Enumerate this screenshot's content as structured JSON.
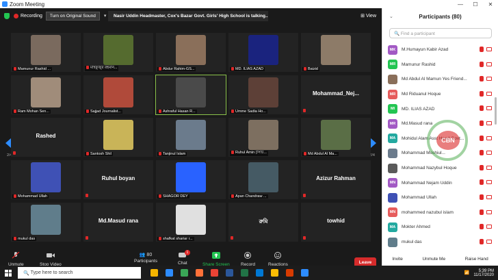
{
  "window": {
    "title": "Zoom Meeting",
    "controls": [
      "—",
      "☐",
      "✕"
    ]
  },
  "topbar": {
    "recording_label": "Recording",
    "sound_button": "Turn on Original Sound",
    "more": "▾",
    "speaker_banner": "Nasir   Uddin Headmaster, Cox's Bazar Govt. Girls' High School is talking...",
    "view_label": "View"
  },
  "pagination": {
    "left": "2/4",
    "right": "2/4"
  },
  "tiles": [
    {
      "name": "Mamunur Rashid ...",
      "photo": "#7a6a5e",
      "kind": "video"
    },
    {
      "name": "মাহফুজুর রহমান...",
      "photo": "#556b2f",
      "kind": "video"
    },
    {
      "name": "Abdur Rahim-GS...",
      "photo": "#8a6f5a",
      "kind": "video"
    },
    {
      "name": "MD. ILIAS AZAD",
      "photo": "#1a237e",
      "kind": "video"
    },
    {
      "name": "Baizid",
      "photo": "#8d7b68",
      "kind": "video"
    },
    {
      "name": "Ram Mohan Sen...",
      "photo": "#a08c7a",
      "kind": "video"
    },
    {
      "name": "Sajjad Journalist...",
      "photo": "#b04a3a",
      "kind": "video"
    },
    {
      "name": "Ashraful Hasan R...",
      "photo": "#4a4a4a",
      "kind": "video",
      "active": true
    },
    {
      "name": "Umme Sadia Ho...",
      "photo": "#5d4037",
      "kind": "video"
    },
    {
      "name": "Mohammad_Nej...",
      "kind": "name"
    },
    {
      "name": "Rashed",
      "kind": "name"
    },
    {
      "name": "Santosh Shil",
      "photo": "#c9b458",
      "kind": "video"
    },
    {
      "name": "Tanjinul Islam",
      "photo": "#6b7b8c",
      "kind": "video"
    },
    {
      "name": "Ruhul Amin (সিটি...",
      "photo": "#7d6f60",
      "kind": "video"
    },
    {
      "name": "Md Abdul Al Ma...",
      "photo": "#5a6e46",
      "kind": "video"
    },
    {
      "name": "Mohammad Ullah",
      "photo": "#3f51b5",
      "kind": "video"
    },
    {
      "name": "Ruhul boyan",
      "kind": "name"
    },
    {
      "name": "SHAGOR DEY",
      "photo": "#2962ff",
      "kind": "video"
    },
    {
      "name": "Apan Chandraw ...",
      "photo": "#455a64",
      "kind": "video"
    },
    {
      "name": "Azizur Rahman",
      "kind": "name"
    },
    {
      "name": "mukul das",
      "photo": "#607d8b",
      "kind": "video"
    },
    {
      "name": "Md.Masud rana",
      "kind": "name"
    },
    {
      "name": "shafkat shariar r...",
      "photo": "#e0e0e0",
      "kind": "video"
    },
    {
      "name": "রুমি",
      "kind": "name"
    },
    {
      "name": "towhid",
      "kind": "name"
    }
  ],
  "toolbar": {
    "unmute": "Unmute",
    "stop_video": "Stop Video",
    "participants": "Participants",
    "participants_count": "80",
    "chat": "Chat",
    "chat_badge": "1",
    "share_screen": "Share Screen",
    "record": "Record",
    "reactions": "Reactions",
    "leave": "Leave"
  },
  "panel": {
    "title": "Participants (80)",
    "search_placeholder": "Find a participant",
    "participants": [
      {
        "initials": "MK",
        "name": "M.Humayun Kabir Azad",
        "color": "#a259c4"
      },
      {
        "initials": "MR",
        "name": "Mamunur Rashid",
        "color": "#23c552"
      },
      {
        "initials": "",
        "name": "Md Abdul Al Mamun Yes Friend...",
        "color": "#8a6f5a"
      },
      {
        "initials": "MR",
        "name": "Md Riduanul Hoque",
        "color": "#e65c5c"
      },
      {
        "initials": "MI",
        "name": "MD. ILIAS AZAD",
        "color": "#23c552"
      },
      {
        "initials": "MR",
        "name": "Md.Masud rana",
        "color": "#a259c4"
      },
      {
        "initials": "MA",
        "name": "Mohidul Alam Asst Head Govt...",
        "color": "#23a9a0"
      },
      {
        "initials": "",
        "name": "Mohammad Moshiul...",
        "color": "#6b7b8c"
      },
      {
        "initials": "",
        "name": "Mohammad Nazybul Hoque",
        "color": "#5a5a5a"
      },
      {
        "initials": "MN",
        "name": "Mohammad Nejam Uddin",
        "color": "#a259c4"
      },
      {
        "initials": "",
        "name": "Mohammad Ullah",
        "color": "#3f51b5"
      },
      {
        "initials": "MN",
        "name": "mohammed nazubul islam",
        "color": "#e65c5c"
      },
      {
        "initials": "MA",
        "name": "Mokter Ahmed",
        "color": "#23a9a0"
      },
      {
        "initials": "",
        "name": "mukul das",
        "color": "#607d8b"
      }
    ],
    "footer": {
      "invite": "Invite",
      "unmute_me": "Unmute Me",
      "raise_hand": "Raise Hand"
    },
    "watermark": "CBN"
  },
  "taskbar": {
    "search_placeholder": "Type here to search",
    "time": "5:39 PM",
    "date": "11/17/2020",
    "apps": [
      "#f4b400",
      "#2d8cff",
      "#3aa757",
      "#ff7139",
      "#ea4335",
      "#2b579a",
      "#217346",
      "#0078d4",
      "#fbbc04",
      "#d83b01",
      "#2d8cff"
    ]
  }
}
